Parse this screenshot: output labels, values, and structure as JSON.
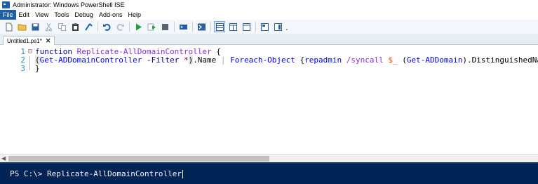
{
  "window": {
    "title": "Administrator: Windows PowerShell ISE"
  },
  "menu": {
    "items": [
      "File",
      "Edit",
      "View",
      "Tools",
      "Debug",
      "Add-ons",
      "Help"
    ],
    "active": "File"
  },
  "toolbar": {
    "buttons": [
      "new-icon",
      "open-icon",
      "save-icon",
      "cut-icon",
      "copy-icon",
      "paste-icon",
      "clear-console-icon",
      "undo-icon",
      "redo-icon",
      "run-icon",
      "run-selection-icon",
      "stop-icon",
      "remote-powershell-icon",
      "console-icon",
      "script-pane-top-icon",
      "script-pane-right-icon",
      "script-pane-maximized-icon",
      "show-command-icon",
      "show-command-addon-icon",
      "overflow-icon"
    ]
  },
  "tab": {
    "label": "Untitled1.ps1*",
    "close": "✕"
  },
  "editor": {
    "lines": [
      {
        "number": "1",
        "fold": "⊟",
        "tokens": [
          {
            "t": "function",
            "c": "kw"
          },
          {
            "t": " ",
            "c": "plain"
          },
          {
            "t": "Replicate-AllDomainController",
            "c": "fn"
          },
          {
            "t": " {",
            "c": "plain"
          }
        ]
      },
      {
        "number": "2",
        "fold": "",
        "tokens": [
          {
            "t": "(",
            "c": "brace"
          },
          {
            "t": "Get-ADDomainController",
            "c": "cmd"
          },
          {
            "t": " ",
            "c": "plain"
          },
          {
            "t": "-Filter",
            "c": "param"
          },
          {
            "t": " ",
            "c": "plain"
          },
          {
            "t": "*",
            "c": "str"
          },
          {
            "t": ")",
            "c": "brace"
          },
          {
            "t": ".Name",
            "c": "plain"
          },
          {
            "t": " | ",
            "c": "op"
          },
          {
            "t": "Foreach-Object",
            "c": "cmd"
          },
          {
            "t": " {",
            "c": "plain"
          },
          {
            "t": "repadmin",
            "c": "cmd"
          },
          {
            "t": " /syncall ",
            "c": "fn"
          },
          {
            "t": "$_",
            "c": "var"
          },
          {
            "t": " (",
            "c": "plain"
          },
          {
            "t": "Get-ADDomain",
            "c": "cmd"
          },
          {
            "t": ").DistinguishedName /",
            "c": "plain"
          }
        ]
      },
      {
        "number": "3",
        "fold": "",
        "tokens": [
          {
            "t": "}",
            "c": "plain"
          }
        ]
      }
    ]
  },
  "console": {
    "prompt": "PS C:\\> ",
    "input": "Replicate-AllDomainController"
  },
  "colors": {
    "console_bg": "#012456",
    "menu_active": "#1f5fa6",
    "line_numbers": "#2b91af"
  }
}
